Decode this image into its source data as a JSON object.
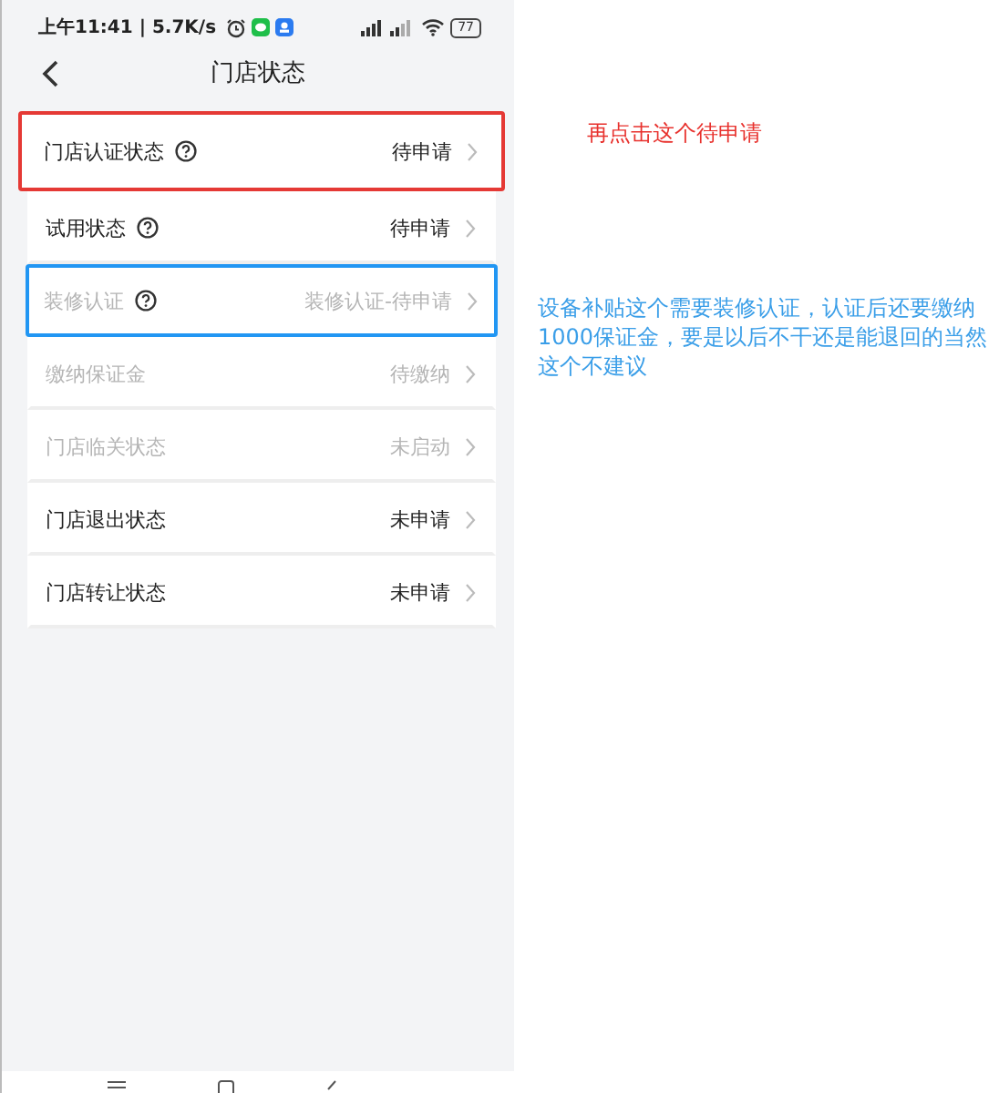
{
  "status_bar": {
    "time": "上午11:41 | 5.7K/s",
    "battery": "77"
  },
  "header": {
    "title": "门店状态"
  },
  "rows": [
    {
      "label": "门店认证状态",
      "help": true,
      "value": "待申请",
      "muted": false,
      "color": "#e53935"
    },
    {
      "label": "试用状态",
      "help": true,
      "value": "待申请",
      "muted": false
    },
    {
      "label": "装修认证",
      "help": true,
      "value": "装修认证-待申请",
      "muted": true,
      "color": "#2196f3"
    },
    {
      "label": "缴纳保证金",
      "help": false,
      "value": "待缴纳",
      "muted": true
    },
    {
      "label": "门店临关状态",
      "help": false,
      "value": "未启动",
      "muted": true
    },
    {
      "label": "门店退出状态",
      "help": false,
      "value": "未申请",
      "muted": false
    },
    {
      "label": "门店转让状态",
      "help": false,
      "value": "未申请",
      "muted": false
    }
  ],
  "notes": [
    {
      "text": "再点击这个待申请",
      "color": "#e8322e"
    },
    {
      "text": "设备补贴这个需要装修认证，认证后还要缴纳1000保证金，要是以后不干还是能退回的当然这个不建议",
      "color": "#3a9ee8"
    }
  ]
}
